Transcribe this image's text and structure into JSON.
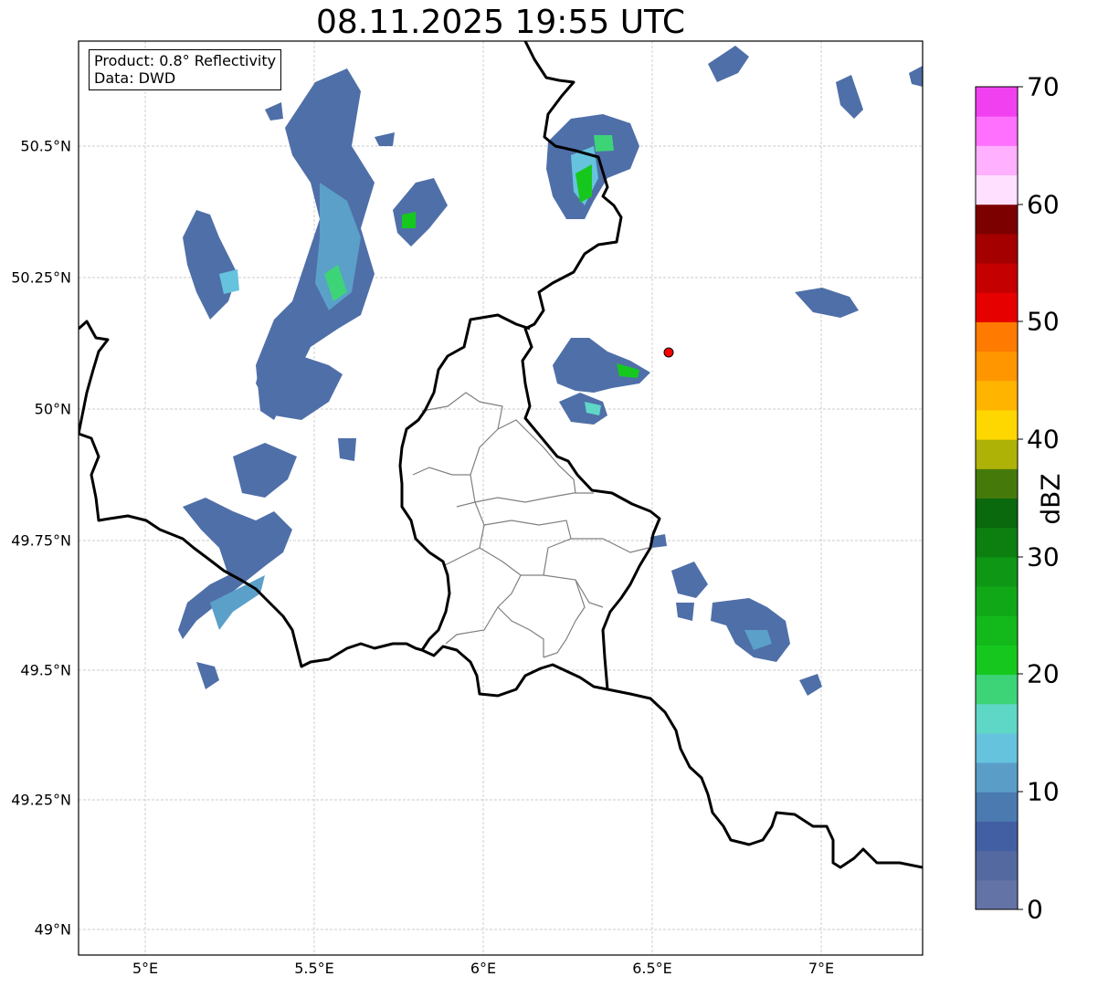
{
  "title": "08.11.2025 19:55 UTC",
  "info_box": {
    "product": "Product: 0.8° Reflectivity",
    "data": "Data: DWD"
  },
  "map": {
    "lat_ticks": [
      "50.5°N",
      "50.25°N",
      "50°N",
      "49.75°N",
      "49.5°N",
      "49.25°N",
      "49°N"
    ],
    "lon_ticks": [
      "5°E",
      "5.5°E",
      "6°E",
      "6.5°E",
      "7°E"
    ],
    "extent": {
      "lon_min": 4.8,
      "lon_max": 7.3,
      "lat_min": 48.95,
      "lat_max": 50.7
    },
    "marker": {
      "lon": 6.55,
      "lat": 50.11,
      "color": "#ff0000"
    }
  },
  "colorbar": {
    "label": "dBZ",
    "ticks": [
      "0",
      "10",
      "20",
      "30",
      "40",
      "50",
      "60",
      "70"
    ],
    "colors": [
      "#6473a5",
      "#5469a0",
      "#435fa3",
      "#4a7ab0",
      "#5a9ec8",
      "#66c3dd",
      "#5fd7c6",
      "#3dd478",
      "#16c81e",
      "#13b81b",
      "#11a818",
      "#0e9714",
      "#0c7f10",
      "#0a690c",
      "#457a0a",
      "#aeb207",
      "#ffd700",
      "#ffb400",
      "#ff9600",
      "#ff7a00",
      "#e60000",
      "#c40000",
      "#a50000",
      "#7c0000",
      "#ffe0ff",
      "#ffb0ff",
      "#ff70ff",
      "#f040f0"
    ]
  }
}
